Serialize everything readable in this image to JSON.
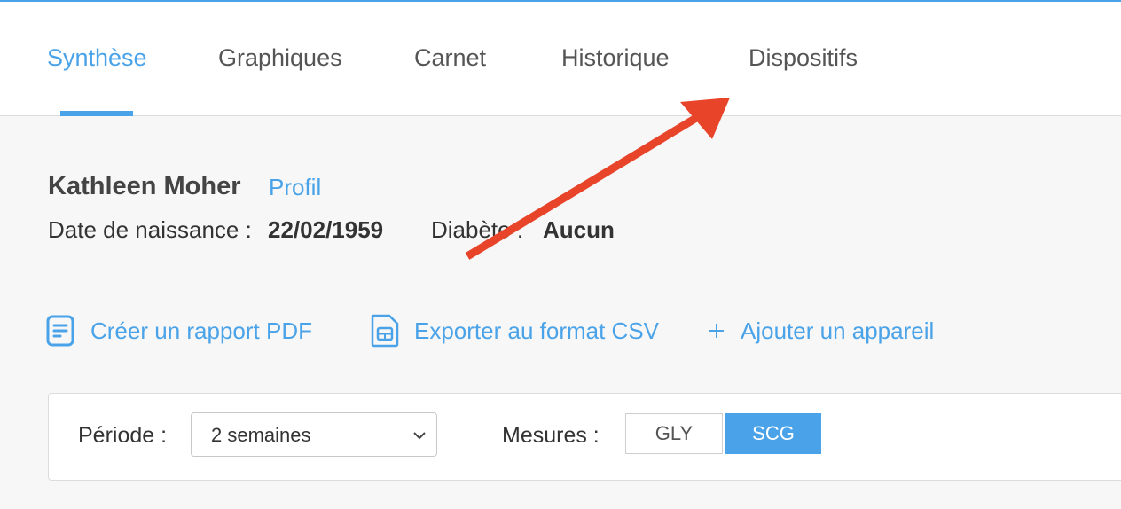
{
  "nav": {
    "tabs": [
      {
        "label": "Synthèse",
        "active": true
      },
      {
        "label": "Graphiques",
        "active": false
      },
      {
        "label": "Carnet",
        "active": false
      },
      {
        "label": "Historique",
        "active": false
      },
      {
        "label": "Dispositifs",
        "active": false
      }
    ]
  },
  "patient": {
    "name": "Kathleen Moher",
    "profile_link": "Profil",
    "dob_label": "Date de naissance :",
    "dob_value": "22/02/1959",
    "diabetes_label": "Diabète :",
    "diabetes_value": "Aucun"
  },
  "actions": {
    "pdf_label": "Créer un rapport PDF",
    "csv_label": "Exporter au format CSV",
    "add_device_label": "Ajouter un appareil",
    "pdf_icon": "document-icon",
    "csv_icon": "spreadsheet-icon",
    "add_icon": "plus-icon"
  },
  "filters": {
    "period_label": "Période :",
    "period_value": "2 semaines",
    "measures_label": "Mesures :",
    "measure_options": [
      "GLY",
      "SCG"
    ],
    "measure_selected": "SCG"
  },
  "colors": {
    "accent": "#4aa3e8",
    "annotation_arrow": "#e8442a"
  }
}
